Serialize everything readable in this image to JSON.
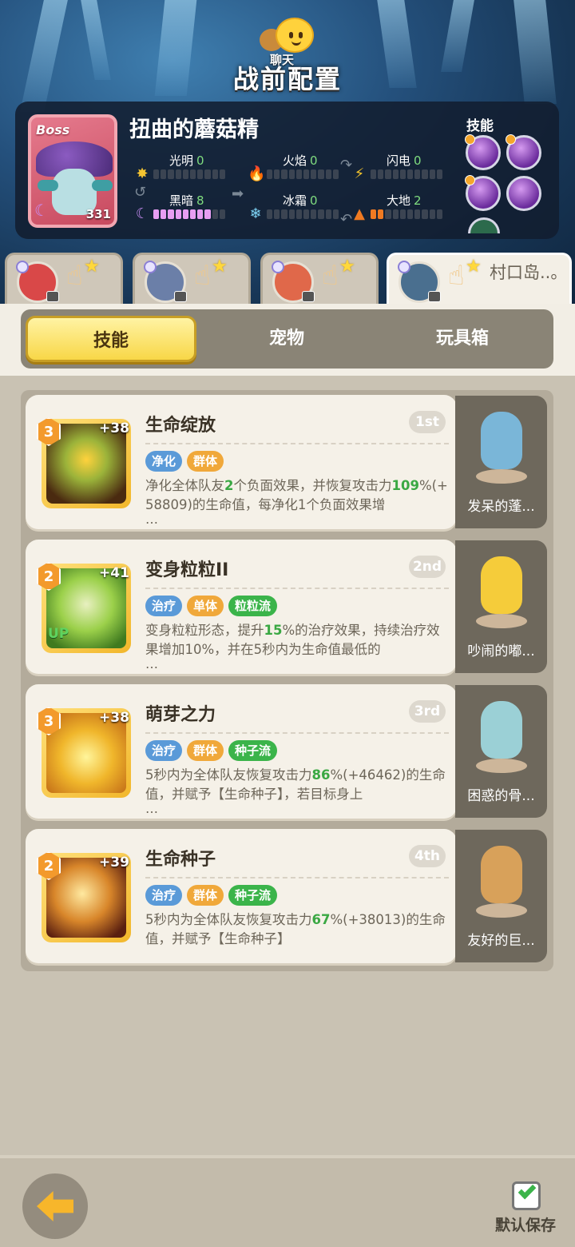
{
  "header": {
    "chat_label": "聊天",
    "title": "战前配置"
  },
  "boss": {
    "tag": "Boss",
    "level": "331",
    "name": "扭曲的蘑菇精",
    "elements": [
      {
        "name": "光明",
        "value": "0",
        "filled": 0,
        "icon": "sun-icon",
        "color": "#f5c431"
      },
      {
        "name": "火焰",
        "value": "0",
        "filled": 0,
        "icon": "flame-icon",
        "color": "#e84a2c"
      },
      {
        "name": "闪电",
        "value": "0",
        "filled": 0,
        "icon": "lightning-icon",
        "color": "#f7c62c"
      },
      {
        "name": "黑暗",
        "value": "8",
        "filled": 8,
        "icon": "moon-icon",
        "color": "#c78cf3"
      },
      {
        "name": "冰霜",
        "value": "0",
        "filled": 0,
        "icon": "snowflake-icon",
        "color": "#7fd5f7"
      },
      {
        "name": "大地",
        "value": "2",
        "filled": 2,
        "icon": "mountain-icon",
        "color": "#ef7a22"
      }
    ],
    "skills_label": "技能"
  },
  "team_tabs": [
    {
      "name": "",
      "avatar_color": "#d94848"
    },
    {
      "name": "",
      "avatar_color": "#6b7fa8"
    },
    {
      "name": "",
      "avatar_color": "#e0684a"
    },
    {
      "name": "村口岛..。",
      "avatar_color": "#4a6f8f"
    }
  ],
  "sub_tabs": [
    "技能",
    "宠物",
    "玩具箱"
  ],
  "skills": [
    {
      "name": "生命绽放",
      "rank": "1st",
      "level": "3",
      "plus": "+38",
      "tags": [
        {
          "text": "净化",
          "color": "blue"
        },
        {
          "text": "群体",
          "color": "orange"
        }
      ],
      "desc_pre": "净化全体队友",
      "desc_g1": "2",
      "desc_mid": "个负面效果，并恢复攻击力",
      "desc_g2": "109",
      "desc_post": "%(+58809)的生命值，每净化1个负面效果增",
      "more": "…",
      "art": "flower-heart",
      "pet_name": "发呆的蓬...",
      "pet_color": "#7ab6d8"
    },
    {
      "name": "变身粒粒II",
      "rank": "2nd",
      "level": "2",
      "plus": "+41",
      "up": "UP",
      "tags": [
        {
          "text": "治疗",
          "color": "blue"
        },
        {
          "text": "单体",
          "color": "orange"
        },
        {
          "text": "粒粒流",
          "color": "green"
        }
      ],
      "desc_pre": "变身粒粒形态，提升",
      "desc_g1": "15",
      "desc_mid": "%的治疗效果，持续治疗效果增加10%，并在5秒内为生命值最低的",
      "desc_g2": "",
      "desc_post": "",
      "more": "…",
      "art": "owl",
      "pet_name": "吵闹的嘟...",
      "pet_color": "#f5cc3a"
    },
    {
      "name": "萌芽之力",
      "rank": "3rd",
      "level": "3",
      "plus": "+38",
      "tags": [
        {
          "text": "治疗",
          "color": "blue"
        },
        {
          "text": "群体",
          "color": "orange"
        },
        {
          "text": "种子流",
          "color": "green"
        }
      ],
      "desc_pre": "5秒内为全体队友恢复攻击力",
      "desc_g1": "86",
      "desc_mid": "%(+46462)的生命值，并赋予【生命种子】，若目标身上",
      "desc_g2": "",
      "desc_post": "",
      "more": "…",
      "art": "sprout",
      "pet_name": "困惑的骨...",
      "pet_color": "#9bd0d6"
    },
    {
      "name": "生命种子",
      "rank": "4th",
      "level": "2",
      "plus": "+39",
      "tags": [
        {
          "text": "治疗",
          "color": "blue"
        },
        {
          "text": "群体",
          "color": "orange"
        },
        {
          "text": "种子流",
          "color": "green"
        }
      ],
      "desc_pre": "5秒内为全体队友恢复攻击力",
      "desc_g1": "67",
      "desc_mid": "%(+38013)的生命值，并赋予【生命种子】",
      "desc_g2": "",
      "desc_post": "",
      "more": "",
      "art": "seed",
      "pet_name": "友好的巨...",
      "pet_color": "#d8a15a"
    }
  ],
  "bottom": {
    "save_label": "默认保存"
  }
}
